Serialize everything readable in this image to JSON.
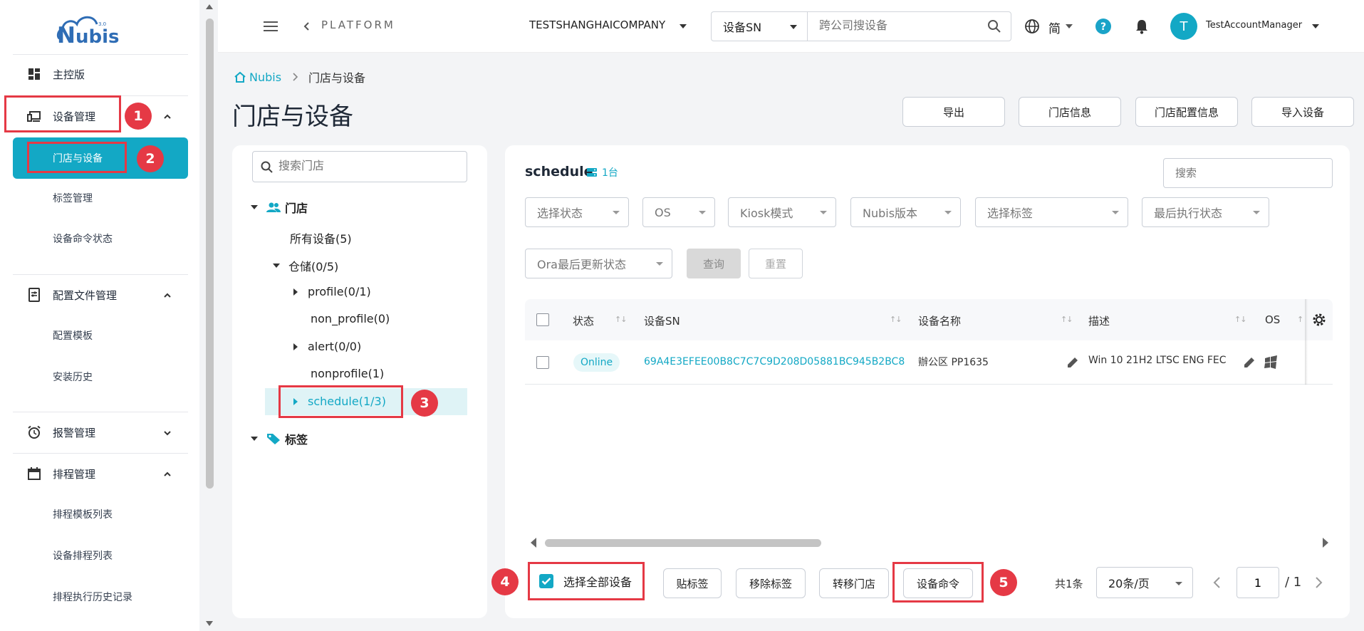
{
  "brand": {
    "logo_text": "Nubis",
    "logo_sup": "3.0"
  },
  "sidebar": {
    "dashboard": "主控版",
    "device_mgmt": "设备管理",
    "store_device": "门店与设备",
    "tag_mgmt": "标签管理",
    "cmd_status": "设备命令状态",
    "config_mgmt": "配置文件管理",
    "config_tpl": "配置模板",
    "install_history": "安装历史",
    "alert_mgmt": "报警管理",
    "schedule_mgmt": "排程管理",
    "schedule_tpl": "排程模板列表",
    "device_schedule": "设备排程列表",
    "schedule_history": "排程执行历史记录"
  },
  "header": {
    "platform": "PLATFORM",
    "company": "TESTSHANGHAICOMPANY",
    "search_type": "设备SN",
    "search_placeholder": "跨公司搜设备",
    "lang": "简",
    "avatar_letter": "T",
    "username": "TestAccountManager"
  },
  "breadcrumb": {
    "home": "Nubis",
    "current": "门店与设备"
  },
  "page_title": "门店与设备",
  "top_buttons": {
    "export": "导出",
    "store_info": "门店信息",
    "store_config": "门店配置信息",
    "import": "导入设备"
  },
  "tree": {
    "search_placeholder": "搜索门店",
    "stores": "门店",
    "all_devices": "所有设备(5)",
    "warehouse": "仓储(0/5)",
    "profile": "profile(0/1)",
    "non_profile": "non_profile(0)",
    "alert": "alert(0/0)",
    "nonprofile": "nonprofile(1)",
    "schedule": "schedule(1/3)",
    "tags": "标签"
  },
  "main": {
    "title": "schedule",
    "count": "1台",
    "search_placeholder": "搜索",
    "filters": {
      "status": "选择状态",
      "os": "OS",
      "kiosk": "Kiosk模式",
      "nubis_ver": "Nubis版本",
      "tag": "选择标签",
      "last_exec": "最后执行状态",
      "ora": "Ora最后更新状态"
    },
    "query": "查询",
    "reset": "重置",
    "columns": {
      "status": "状态",
      "sn": "设备SN",
      "name": "设备名称",
      "desc": "描述",
      "os": "OS"
    },
    "row": {
      "status": "Online",
      "sn": "69A4E3EFEE00B8C7C7C9D208D05881BC945B2BC8",
      "name": "辦公区 PP1635",
      "desc": "Win 10 21H2 LTSC ENG FEC"
    }
  },
  "bottom": {
    "select_all": "选择全部设备",
    "add_tag": "贴标签",
    "remove_tag": "移除标签",
    "move_store": "转移门店",
    "device_cmd": "设备命令",
    "total": "共1条",
    "page_size": "20条/页",
    "page": "1",
    "page_total": "/ 1"
  },
  "annotations": {
    "n1": "1",
    "n2": "2",
    "n3": "3",
    "n4": "4",
    "n5": "5"
  },
  "colors": {
    "accent": "#13a8c5",
    "annotation": "#e53945",
    "help": "#1aa3c8"
  }
}
